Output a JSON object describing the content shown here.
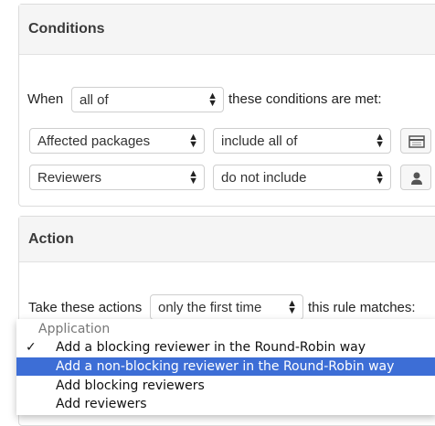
{
  "conditions": {
    "title": "Conditions",
    "when_label": "When",
    "match_value": "all of",
    "met_label": "these conditions are met:",
    "rows": [
      {
        "field": "Affected packages",
        "operator": "include all of",
        "icon": "table-icon"
      },
      {
        "field": "Reviewers",
        "operator": "do not include",
        "icon": "user-icon"
      }
    ]
  },
  "action": {
    "title": "Action",
    "prefix_label": "Take these actions",
    "frequency_value": "only the first time",
    "suffix_label": "this rule matches:"
  },
  "dropdown": {
    "group_label": "Application",
    "items": [
      {
        "label": "Add a blocking reviewer in the Round-Robin way",
        "checked": true,
        "highlighted": false
      },
      {
        "label": "Add a non-blocking reviewer in the Round-Robin way",
        "checked": false,
        "highlighted": true
      },
      {
        "label": "Add blocking reviewers",
        "checked": false,
        "highlighted": false
      },
      {
        "label": "Add reviewers",
        "checked": false,
        "highlighted": false
      }
    ],
    "checkmark": "✓",
    "highlight_color": "#3d6ed6"
  }
}
